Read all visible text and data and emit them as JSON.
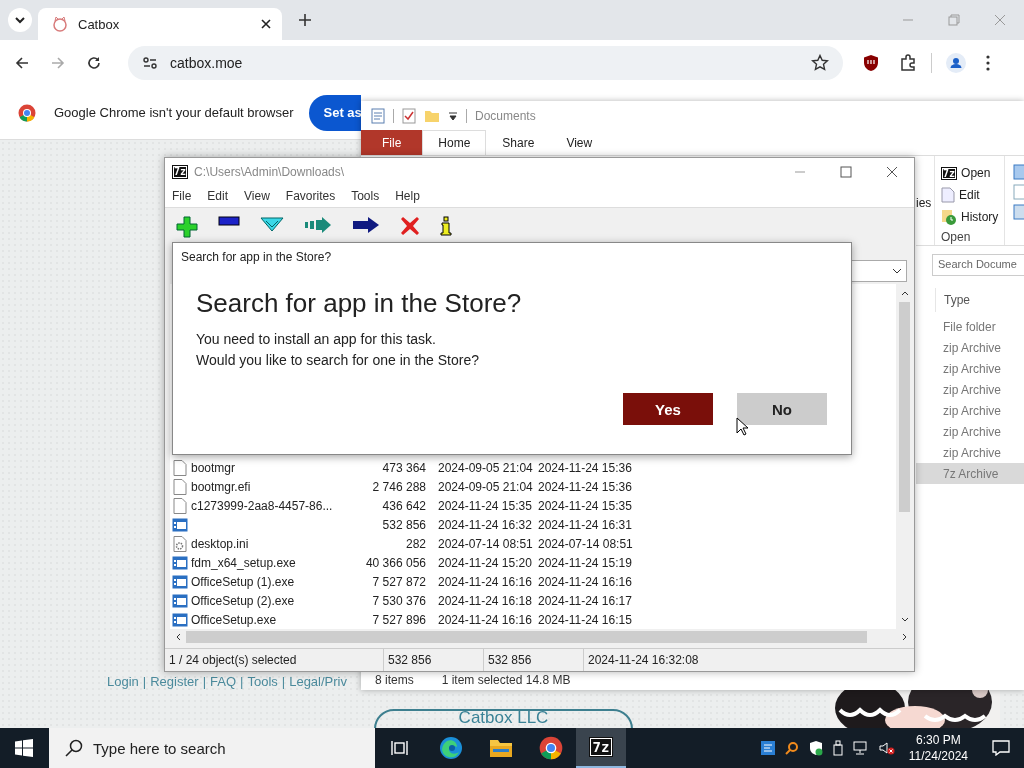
{
  "browser": {
    "tabs": [
      {
        "title": "Catbox",
        "selected": true
      }
    ],
    "address": "catbox.moe",
    "infobar": {
      "message": "Google Chrome isn't your default browser",
      "button": "Set as"
    },
    "footer": {
      "links": [
        "Login",
        "Register",
        "FAQ",
        "Tools",
        "Legal/Priv"
      ],
      "separator": "|"
    },
    "company": "Catbox LLC"
  },
  "explorer": {
    "title": "Documents",
    "ribbon_tabs": [
      {
        "label": "File",
        "kind": "file",
        "selected": false
      },
      {
        "label": "Home",
        "kind": "tab",
        "selected": true
      },
      {
        "label": "Share",
        "kind": "tab",
        "selected": false
      },
      {
        "label": "View",
        "kind": "tab",
        "selected": false
      }
    ],
    "ribbon_fragment": "ies",
    "open_group": {
      "items": [
        {
          "label": "Open",
          "kind": "open",
          "badge": "7z"
        },
        {
          "label": "Edit",
          "kind": "edit"
        },
        {
          "label": "History",
          "kind": "history"
        }
      ],
      "label": "Open"
    },
    "search": {
      "placeholder": "Search Docume"
    },
    "column": "Type",
    "types": [
      {
        "text": "File folder",
        "selected": false
      },
      {
        "text": "zip Archive",
        "selected": false
      },
      {
        "text": "zip Archive",
        "selected": false
      },
      {
        "text": "zip Archive",
        "selected": false
      },
      {
        "text": "zip Archive",
        "selected": false
      },
      {
        "text": "zip Archive",
        "selected": false
      },
      {
        "text": "zip Archive",
        "selected": false
      },
      {
        "text": "7z Archive",
        "selected": true
      }
    ],
    "status": [
      "8 items",
      "1 item selected  14.8 MB"
    ]
  },
  "sevenzip": {
    "logo": "7z",
    "title": "C:\\Users\\Admin\\Downloads\\",
    "menu": [
      "File",
      "Edit",
      "View",
      "Favorites",
      "Tools",
      "Help"
    ],
    "rows": [
      {
        "kind": "file",
        "name": "bootmgr",
        "size": "473 364",
        "modified": "2024-09-05 21:04",
        "created": "2024-11-24 15:36"
      },
      {
        "kind": "file",
        "name": "bootmgr.efi",
        "size": "2 746 288",
        "modified": "2024-09-05 21:04",
        "created": "2024-11-24 15:36"
      },
      {
        "kind": "file",
        "name": "c1273999-2aa8-4457-86...",
        "size": "436 642",
        "modified": "2024-11-24 15:35",
        "created": "2024-11-24 15:35"
      },
      {
        "kind": "exe",
        "size": "532 856",
        "modified": "2024-11-24 16:32",
        "created": "2024-11-24 16:31"
      },
      {
        "kind": "ini",
        "name": "desktop.ini",
        "size": "282",
        "modified": "2024-07-14 08:51",
        "created": "2024-07-14 08:51"
      },
      {
        "kind": "exe",
        "name": "fdm_x64_setup.exe",
        "size": "40 366 056",
        "modified": "2024-11-24 15:20",
        "created": "2024-11-24 15:19"
      },
      {
        "kind": "exe",
        "name": "OfficeSetup (1).exe",
        "size": "7 527 872",
        "modified": "2024-11-24 16:16",
        "created": "2024-11-24 16:16"
      },
      {
        "kind": "exe",
        "name": "OfficeSetup (2).exe",
        "size": "7 530 376",
        "modified": "2024-11-24 16:18",
        "created": "2024-11-24 16:17"
      },
      {
        "kind": "exe",
        "name": "OfficeSetup.exe",
        "size": "7 527 896",
        "modified": "2024-11-24 16:16",
        "created": "2024-11-24 16:15"
      }
    ],
    "status": [
      "1 / 24 object(s) selected",
      "532 856",
      "532 856",
      "2024-11-24 16:32:08"
    ]
  },
  "dialog": {
    "caption": "Search for app in the Store?",
    "heading": "Search for app in the Store?",
    "lines": [
      "You need to install an app for this task.",
      "Would you like to search for one in the Store?"
    ],
    "buttons": [
      {
        "label": "Yes",
        "kind": "primary"
      },
      {
        "label": "No",
        "kind": "secondary"
      }
    ]
  },
  "taskbar": {
    "search_placeholder": "Type here to search",
    "apps": [
      {
        "kind": "taskview",
        "selected": false
      },
      {
        "kind": "edge",
        "selected": false
      },
      {
        "kind": "folder",
        "selected": false
      },
      {
        "kind": "chrome",
        "selected": false
      },
      {
        "kind": "sevenzip",
        "label": "7z",
        "selected": true
      }
    ],
    "time": "6:30 PM",
    "date": "11/24/2024"
  }
}
